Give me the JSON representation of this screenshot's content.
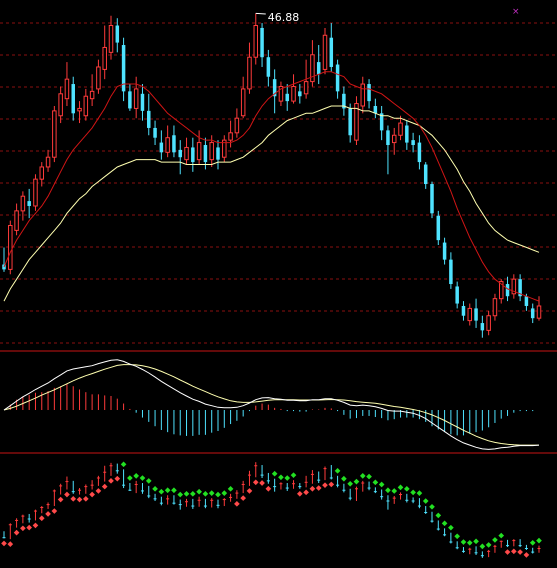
{
  "colors": {
    "background": "#000000",
    "up": "#ff3b3b",
    "down": "#4fe3ff",
    "ma_short": "#d01515",
    "ma_long": "#ffffb0",
    "grid": "#8a1010",
    "divider": "#c81414",
    "macd_up": "#ff3b3b",
    "macd_down": "#4fe3ff",
    "sar_up": "#ff4a4a",
    "sar_down": "#22e022",
    "peak_label": "#ffffff"
  },
  "chart_data": [
    {
      "type": "candlestick",
      "panel": "price",
      "peak_label": "46.88",
      "ylim": [
        33.3,
        47.2
      ],
      "candles": [
        [
          36.6,
          36.4,
          37.3,
          36.3
        ],
        [
          36.4,
          38.2,
          38.4,
          36.2
        ],
        [
          38.0,
          38.8,
          39.1,
          37.8
        ],
        [
          38.8,
          39.4,
          39.6,
          38.4
        ],
        [
          39.2,
          39.0,
          39.7,
          38.5
        ],
        [
          39.0,
          40.1,
          40.3,
          38.8
        ],
        [
          40.1,
          40.6,
          40.8,
          39.8
        ],
        [
          40.6,
          41.0,
          41.3,
          40.4
        ],
        [
          41.0,
          42.9,
          43.1,
          40.8
        ],
        [
          42.7,
          43.6,
          43.9,
          42.4
        ],
        [
          43.4,
          44.2,
          44.9,
          43.1
        ],
        [
          44.0,
          42.8,
          44.3,
          42.5
        ],
        [
          42.9,
          43.0,
          43.3,
          42.4
        ],
        [
          42.7,
          43.5,
          43.8,
          42.5
        ],
        [
          43.4,
          43.7,
          44.4,
          43.1
        ],
        [
          43.8,
          44.7,
          45.0,
          43.6
        ],
        [
          44.6,
          45.5,
          46.4,
          44.2
        ],
        [
          45.3,
          46.4,
          46.8,
          45.0
        ],
        [
          46.4,
          45.7,
          46.7,
          45.3
        ],
        [
          45.6,
          43.7,
          45.9,
          43.3
        ],
        [
          43.7,
          43.0,
          44.0,
          42.9
        ],
        [
          43.0,
          43.8,
          44.3,
          42.6
        ],
        [
          43.6,
          42.9,
          44.0,
          42.5
        ],
        [
          42.9,
          42.2,
          43.6,
          41.9
        ],
        [
          42.2,
          41.8,
          42.5,
          41.5
        ],
        [
          41.6,
          41.2,
          42.1,
          40.9
        ],
        [
          41.2,
          41.8,
          42.3,
          41.0
        ],
        [
          41.9,
          41.2,
          42.3,
          41.0
        ],
        [
          41.3,
          41.0,
          41.7,
          40.3
        ],
        [
          40.9,
          41.4,
          41.8,
          40.7
        ],
        [
          41.4,
          40.8,
          41.8,
          40.4
        ],
        [
          40.9,
          41.6,
          42.1,
          40.7
        ],
        [
          41.5,
          40.8,
          41.8,
          40.5
        ],
        [
          40.9,
          41.6,
          41.9,
          40.6
        ],
        [
          41.4,
          40.9,
          41.7,
          40.5
        ],
        [
          41.0,
          41.7,
          41.9,
          40.8
        ],
        [
          41.7,
          42.0,
          42.5,
          41.4
        ],
        [
          42.0,
          42.6,
          43.0,
          41.8
        ],
        [
          42.7,
          43.8,
          44.3,
          42.6
        ],
        [
          43.8,
          45.1,
          45.7,
          43.6
        ],
        [
          45.1,
          46.4,
          46.9,
          44.8
        ],
        [
          46.3,
          45.1,
          46.5,
          44.7
        ],
        [
          45.1,
          44.3,
          45.4,
          43.9
        ],
        [
          44.2,
          43.5,
          44.6,
          42.8
        ],
        [
          43.3,
          43.9,
          44.1,
          43.1
        ],
        [
          43.6,
          43.3,
          44.0,
          42.9
        ],
        [
          43.3,
          43.9,
          44.4,
          43.2
        ],
        [
          43.7,
          43.5,
          44.0,
          43.2
        ],
        [
          43.6,
          44.1,
          45.0,
          43.4
        ],
        [
          44.1,
          45.2,
          45.8,
          43.9
        ],
        [
          44.9,
          44.4,
          45.6,
          44.0
        ],
        [
          44.6,
          46.0,
          46.3,
          44.4
        ],
        [
          45.9,
          44.7,
          46.5,
          44.5
        ],
        [
          44.8,
          43.7,
          45.0,
          43.4
        ],
        [
          43.6,
          43.0,
          43.9,
          42.7
        ],
        [
          43.0,
          41.9,
          43.2,
          41.6
        ],
        [
          41.7,
          43.2,
          43.5,
          41.5
        ],
        [
          43.1,
          44.0,
          44.3,
          42.8
        ],
        [
          44.0,
          43.3,
          44.2,
          43.0
        ],
        [
          43.1,
          42.8,
          43.4,
          42.6
        ],
        [
          42.8,
          42.1,
          43.1,
          41.7
        ],
        [
          42.1,
          41.5,
          42.3,
          40.3
        ],
        [
          41.6,
          41.9,
          42.2,
          41.1
        ],
        [
          41.9,
          42.4,
          42.7,
          41.7
        ],
        [
          42.3,
          41.6,
          42.5,
          41.3
        ],
        [
          41.7,
          41.5,
          42.0,
          41.2
        ],
        [
          41.6,
          40.8,
          41.9,
          40.5
        ],
        [
          40.7,
          39.9,
          40.8,
          39.7
        ],
        [
          39.9,
          38.7,
          40.0,
          38.5
        ],
        [
          38.6,
          37.6,
          38.8,
          37.4
        ],
        [
          37.5,
          36.8,
          37.7,
          36.6
        ],
        [
          36.8,
          35.8,
          37.1,
          35.6
        ],
        [
          35.7,
          35.0,
          35.9,
          34.8
        ],
        [
          34.9,
          34.5,
          35.1,
          34.3
        ],
        [
          34.3,
          34.8,
          35.0,
          34.1
        ],
        [
          34.8,
          34.3,
          35.2,
          34.0
        ],
        [
          34.2,
          33.9,
          34.5,
          33.6
        ],
        [
          33.9,
          34.5,
          34.7,
          33.7
        ],
        [
          34.5,
          35.2,
          35.4,
          34.3
        ],
        [
          35.2,
          35.9,
          36.0,
          35.0
        ],
        [
          35.8,
          35.3,
          36.1,
          35.1
        ],
        [
          35.4,
          36.0,
          36.2,
          35.2
        ],
        [
          36.0,
          35.3,
          36.2,
          35.1
        ],
        [
          35.3,
          34.9,
          35.4,
          34.7
        ],
        [
          34.8,
          34.4,
          35.0,
          34.2
        ],
        [
          34.4,
          34.9,
          35.3,
          34.3
        ]
      ],
      "ma_short": [
        36.5,
        37.1,
        37.6,
        38.0,
        38.4,
        38.7,
        39.0,
        39.4,
        39.9,
        40.4,
        40.9,
        41.3,
        41.6,
        41.9,
        42.2,
        42.6,
        43.0,
        43.5,
        43.9,
        44.0,
        44.0,
        44.0,
        43.9,
        43.7,
        43.4,
        43.1,
        42.8,
        42.6,
        42.4,
        42.2,
        42.0,
        41.8,
        41.7,
        41.7,
        41.6,
        41.6,
        41.6,
        41.7,
        41.9,
        42.2,
        42.7,
        43.1,
        43.4,
        43.6,
        43.8,
        43.9,
        44.0,
        44.1,
        44.2,
        44.3,
        44.4,
        44.5,
        44.5,
        44.4,
        44.3,
        44.0,
        43.9,
        43.8,
        43.8,
        43.7,
        43.6,
        43.4,
        43.2,
        43.0,
        42.8,
        42.6,
        42.3,
        41.9,
        41.4,
        40.8,
        40.2,
        39.6,
        38.9,
        38.3,
        37.7,
        37.2,
        36.7,
        36.3,
        36.0,
        35.8,
        35.6,
        35.5,
        35.4,
        35.3,
        35.2,
        35.1
      ],
      "ma_long": [
        35.1,
        35.6,
        36.0,
        36.4,
        36.8,
        37.1,
        37.4,
        37.7,
        38.0,
        38.3,
        38.7,
        39.0,
        39.3,
        39.5,
        39.8,
        40.0,
        40.2,
        40.4,
        40.6,
        40.7,
        40.8,
        40.9,
        40.9,
        40.9,
        40.9,
        40.8,
        40.8,
        40.8,
        40.8,
        40.7,
        40.7,
        40.7,
        40.7,
        40.7,
        40.8,
        40.8,
        40.8,
        40.9,
        41.0,
        41.2,
        41.4,
        41.6,
        41.9,
        42.1,
        42.3,
        42.5,
        42.6,
        42.7,
        42.8,
        42.8,
        42.9,
        43.0,
        43.1,
        43.1,
        43.1,
        43.0,
        43.0,
        42.9,
        42.9,
        42.8,
        42.7,
        42.7,
        42.6,
        42.6,
        42.5,
        42.4,
        42.3,
        42.1,
        41.9,
        41.6,
        41.3,
        40.9,
        40.5,
        40.0,
        39.6,
        39.1,
        38.7,
        38.3,
        38.0,
        37.8,
        37.6,
        37.5,
        37.4,
        37.3,
        37.2,
        37.1
      ]
    },
    {
      "type": "macd",
      "panel": "indicator",
      "ylim": [
        -1.8,
        2.0
      ],
      "dif": [
        0.0,
        0.16,
        0.33,
        0.49,
        0.62,
        0.76,
        0.88,
        1.0,
        1.16,
        1.3,
        1.45,
        1.52,
        1.56,
        1.6,
        1.64,
        1.72,
        1.78,
        1.84,
        1.86,
        1.8,
        1.7,
        1.62,
        1.5,
        1.37,
        1.22,
        1.06,
        0.92,
        0.78,
        0.64,
        0.52,
        0.4,
        0.32,
        0.22,
        0.16,
        0.1,
        0.08,
        0.08,
        0.1,
        0.16,
        0.26,
        0.38,
        0.45,
        0.46,
        0.42,
        0.4,
        0.36,
        0.36,
        0.34,
        0.34,
        0.38,
        0.38,
        0.42,
        0.42,
        0.36,
        0.28,
        0.18,
        0.16,
        0.18,
        0.16,
        0.12,
        0.06,
        -0.02,
        -0.04,
        -0.04,
        -0.08,
        -0.12,
        -0.2,
        -0.32,
        -0.48,
        -0.64,
        -0.8,
        -0.96,
        -1.1,
        -1.22,
        -1.3,
        -1.38,
        -1.44,
        -1.46,
        -1.44,
        -1.4,
        -1.38,
        -1.34,
        -1.32,
        -1.32,
        -1.32,
        -1.3
      ],
      "dea": [
        0.0,
        0.06,
        0.14,
        0.24,
        0.34,
        0.44,
        0.55,
        0.65,
        0.75,
        0.86,
        0.97,
        1.08,
        1.18,
        1.27,
        1.35,
        1.43,
        1.51,
        1.58,
        1.65,
        1.68,
        1.68,
        1.67,
        1.64,
        1.59,
        1.52,
        1.43,
        1.33,
        1.23,
        1.11,
        1.0,
        0.88,
        0.78,
        0.68,
        0.58,
        0.49,
        0.41,
        0.34,
        0.3,
        0.28,
        0.28,
        0.3,
        0.33,
        0.36,
        0.38,
        0.38,
        0.38,
        0.38,
        0.37,
        0.37,
        0.37,
        0.37,
        0.38,
        0.39,
        0.38,
        0.37,
        0.34,
        0.31,
        0.29,
        0.27,
        0.25,
        0.21,
        0.17,
        0.13,
        0.1,
        0.06,
        0.02,
        -0.03,
        -0.1,
        -0.18,
        -0.28,
        -0.39,
        -0.51,
        -0.63,
        -0.75,
        -0.86,
        -0.97,
        -1.06,
        -1.14,
        -1.2,
        -1.24,
        -1.27,
        -1.29,
        -1.3,
        -1.3,
        -1.3,
        -1.3
      ],
      "hist": [
        0.0,
        0.2,
        0.38,
        0.5,
        0.56,
        0.64,
        0.66,
        0.7,
        0.82,
        0.88,
        0.96,
        0.88,
        0.76,
        0.66,
        0.58,
        0.58,
        0.54,
        0.52,
        0.42,
        0.24,
        0.04,
        -0.1,
        -0.28,
        -0.44,
        -0.6,
        -0.74,
        -0.82,
        -0.9,
        -0.94,
        -0.96,
        -0.96,
        -0.92,
        -0.92,
        -0.84,
        -0.78,
        -0.66,
        -0.52,
        -0.4,
        -0.24,
        -0.04,
        0.16,
        0.24,
        0.2,
        0.08,
        0.04,
        -0.04,
        -0.04,
        -0.06,
        -0.06,
        0.02,
        0.02,
        0.08,
        0.06,
        -0.04,
        -0.18,
        -0.32,
        -0.3,
        -0.22,
        -0.22,
        -0.26,
        -0.3,
        -0.38,
        -0.34,
        -0.28,
        -0.28,
        -0.28,
        -0.34,
        -0.44,
        -0.6,
        -0.72,
        -0.82,
        -0.9,
        -0.94,
        -0.94,
        -0.88,
        -0.82,
        -0.76,
        -0.64,
        -0.48,
        -0.32,
        -0.22,
        -0.1,
        -0.04,
        -0.04,
        -0.04,
        0.0
      ]
    },
    {
      "type": "sar",
      "panel": "lower",
      "ylim": [
        33.3,
        47.2
      ],
      "sar_dir": [
        "up",
        "up",
        "up",
        "up",
        "up",
        "up",
        "up",
        "up",
        "up",
        "up",
        "up",
        "up",
        "up",
        "up",
        "up",
        "up",
        "up",
        "up",
        "up",
        "down",
        "down",
        "down",
        "down",
        "down",
        "down",
        "down",
        "down",
        "down",
        "down",
        "down",
        "down",
        "down",
        "down",
        "down",
        "down",
        "down",
        "down",
        "up",
        "up",
        "up",
        "up",
        "up",
        "up",
        "down",
        "down",
        "down",
        "down",
        "up",
        "up",
        "up",
        "up",
        "up",
        "up",
        "down",
        "down",
        "down",
        "down",
        "down",
        "down",
        "down",
        "down",
        "down",
        "down",
        "down",
        "down",
        "down",
        "down",
        "down",
        "down",
        "down",
        "down",
        "down",
        "down",
        "down",
        "down",
        "down",
        "down",
        "down",
        "down",
        "down",
        "up",
        "up",
        "up",
        "up",
        "down",
        "down"
      ]
    }
  ]
}
